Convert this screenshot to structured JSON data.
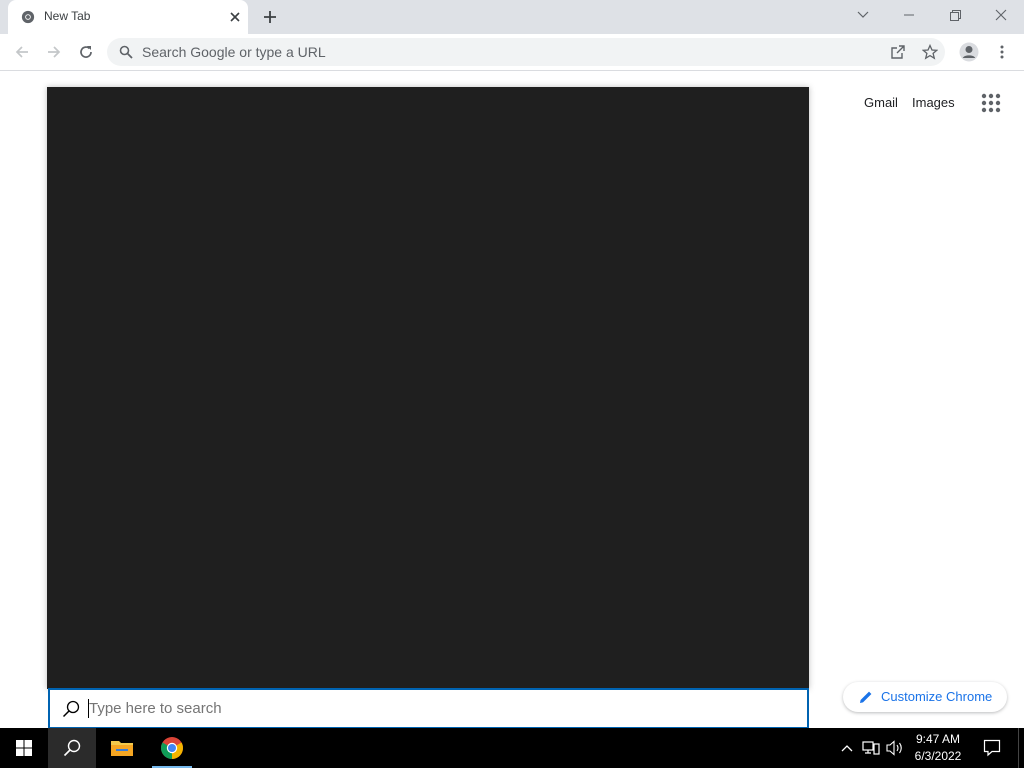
{
  "browser": {
    "tab": {
      "title": "New Tab"
    },
    "omnibox": {
      "placeholder": "Search Google or type a URL"
    }
  },
  "page": {
    "links": {
      "gmail": "Gmail",
      "images": "Images"
    },
    "customize_label": "Customize Chrome"
  },
  "search_flyout": {
    "placeholder": "Type here to search"
  },
  "taskbar": {
    "pinned": [
      "file-explorer",
      "google-chrome"
    ],
    "clock": {
      "time": "9:47 AM",
      "date": "6/3/2022"
    }
  },
  "colors": {
    "accent": "#1a73e8",
    "flyout_bg": "#1f1f1f",
    "search_border": "#0063b1",
    "taskbar_bg": "#000000"
  }
}
